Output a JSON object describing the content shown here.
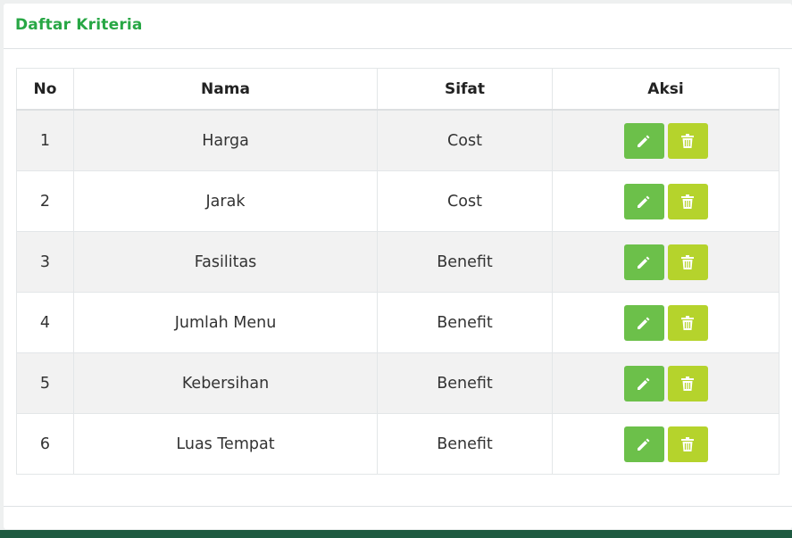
{
  "card": {
    "title": "Daftar Kriteria"
  },
  "table": {
    "headers": {
      "no": "No",
      "nama": "Nama",
      "sifat": "Sifat",
      "aksi": "Aksi"
    },
    "rows": [
      {
        "no": "1",
        "nama": "Harga",
        "sifat": "Cost"
      },
      {
        "no": "2",
        "nama": "Jarak",
        "sifat": "Cost"
      },
      {
        "no": "3",
        "nama": "Fasilitas",
        "sifat": "Benefit"
      },
      {
        "no": "4",
        "nama": "Jumlah Menu",
        "sifat": "Benefit"
      },
      {
        "no": "5",
        "nama": "Kebersihan",
        "sifat": "Benefit"
      },
      {
        "no": "6",
        "nama": "Luas Tempat",
        "sifat": "Benefit"
      }
    ]
  },
  "icons": {
    "edit": "pencil-icon",
    "delete": "trash-icon"
  },
  "colors": {
    "title": "#28a745",
    "edit_button": "#6cc04a",
    "delete_button": "#b5d32c",
    "bottom_bar": "#1e5a40"
  }
}
